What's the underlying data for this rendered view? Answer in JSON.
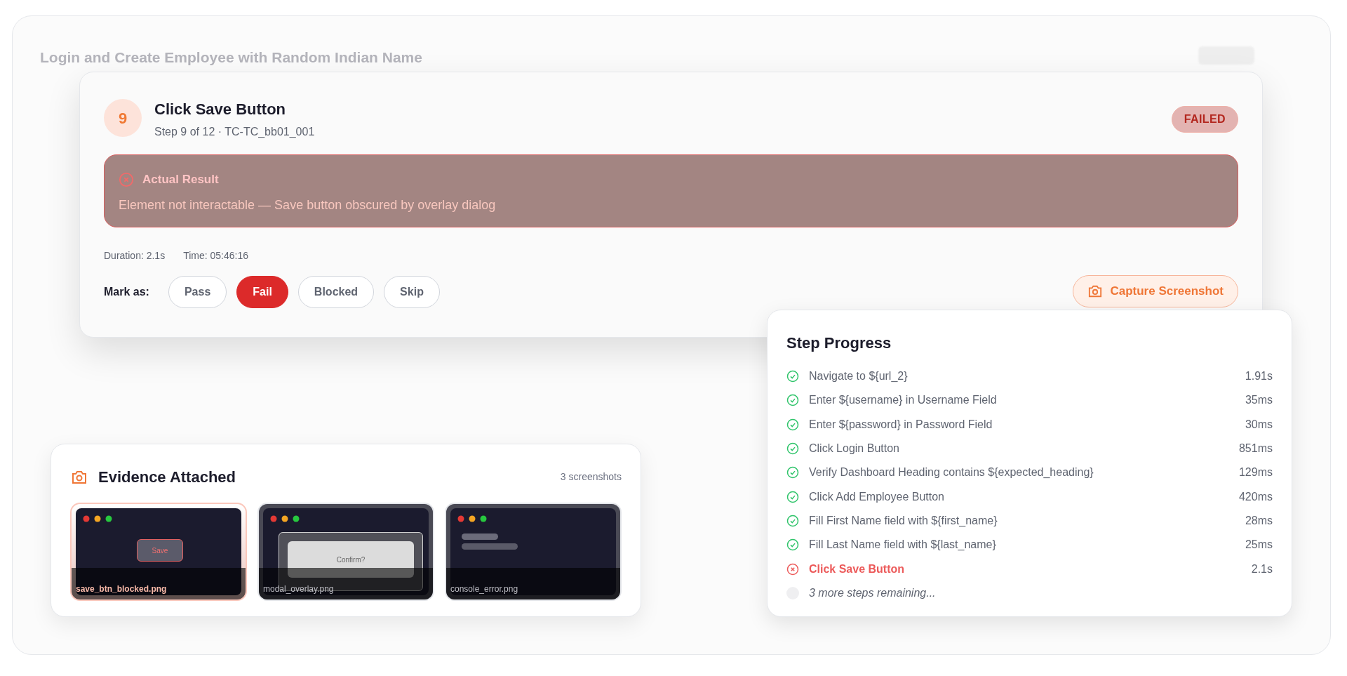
{
  "background_title": "Login and Create Employee with Random Indian Name",
  "step": {
    "number": "9",
    "title": "Click Save Button",
    "subtitle": "Step 9 of 12 · TC-TC_bb01_001",
    "status": "FAILED"
  },
  "actual_result": {
    "label": "Actual Result",
    "message": "Element not interactable — Save button obscured by overlay dialog"
  },
  "duration": "Duration: 2.1s",
  "time": "Time: 05:46:16",
  "mark_as": {
    "label": "Mark as:",
    "options": [
      {
        "label": "Pass",
        "selected": false
      },
      {
        "label": "Fail",
        "selected": true
      },
      {
        "label": "Blocked",
        "selected": false
      },
      {
        "label": "Skip",
        "selected": false
      }
    ]
  },
  "capture_button": "Capture Screenshot",
  "evidence": {
    "title": "Evidence Attached",
    "count": "3 screenshots",
    "screenshots": [
      {
        "kind": "button",
        "filename": "save_btn_blocked.png",
        "selected": true,
        "button_label": "Save"
      },
      {
        "kind": "modal",
        "filename": "modal_overlay.png",
        "selected": false,
        "dialog_text": "Confirm?"
      },
      {
        "kind": "console",
        "filename": "console_error.png",
        "selected": false
      }
    ]
  },
  "step_progress": {
    "title": "Step Progress",
    "steps": [
      {
        "label": "Navigate to ${url_2}",
        "kind": "passed",
        "duration": "1.91s"
      },
      {
        "label": "Enter ${username} in Username Field",
        "kind": "passed",
        "duration": "35ms"
      },
      {
        "label": "Enter ${password} in Password Field",
        "kind": "passed",
        "duration": "30ms"
      },
      {
        "label": "Click Login Button",
        "kind": "passed",
        "duration": "851ms"
      },
      {
        "label": "Verify Dashboard Heading contains ${expected_heading}",
        "kind": "passed",
        "duration": "129ms"
      },
      {
        "label": "Click Add Employee Button",
        "kind": "passed",
        "duration": "420ms"
      },
      {
        "label": "Fill First Name field with ${first_name}",
        "kind": "passed",
        "duration": "28ms"
      },
      {
        "label": "Fill Last Name field with ${last_name}",
        "kind": "passed",
        "duration": "25ms"
      },
      {
        "label": "Click Save Button",
        "kind": "failed",
        "duration": "2.1s"
      },
      {
        "label": "3 more steps remaining...",
        "kind": "pending"
      }
    ]
  }
}
